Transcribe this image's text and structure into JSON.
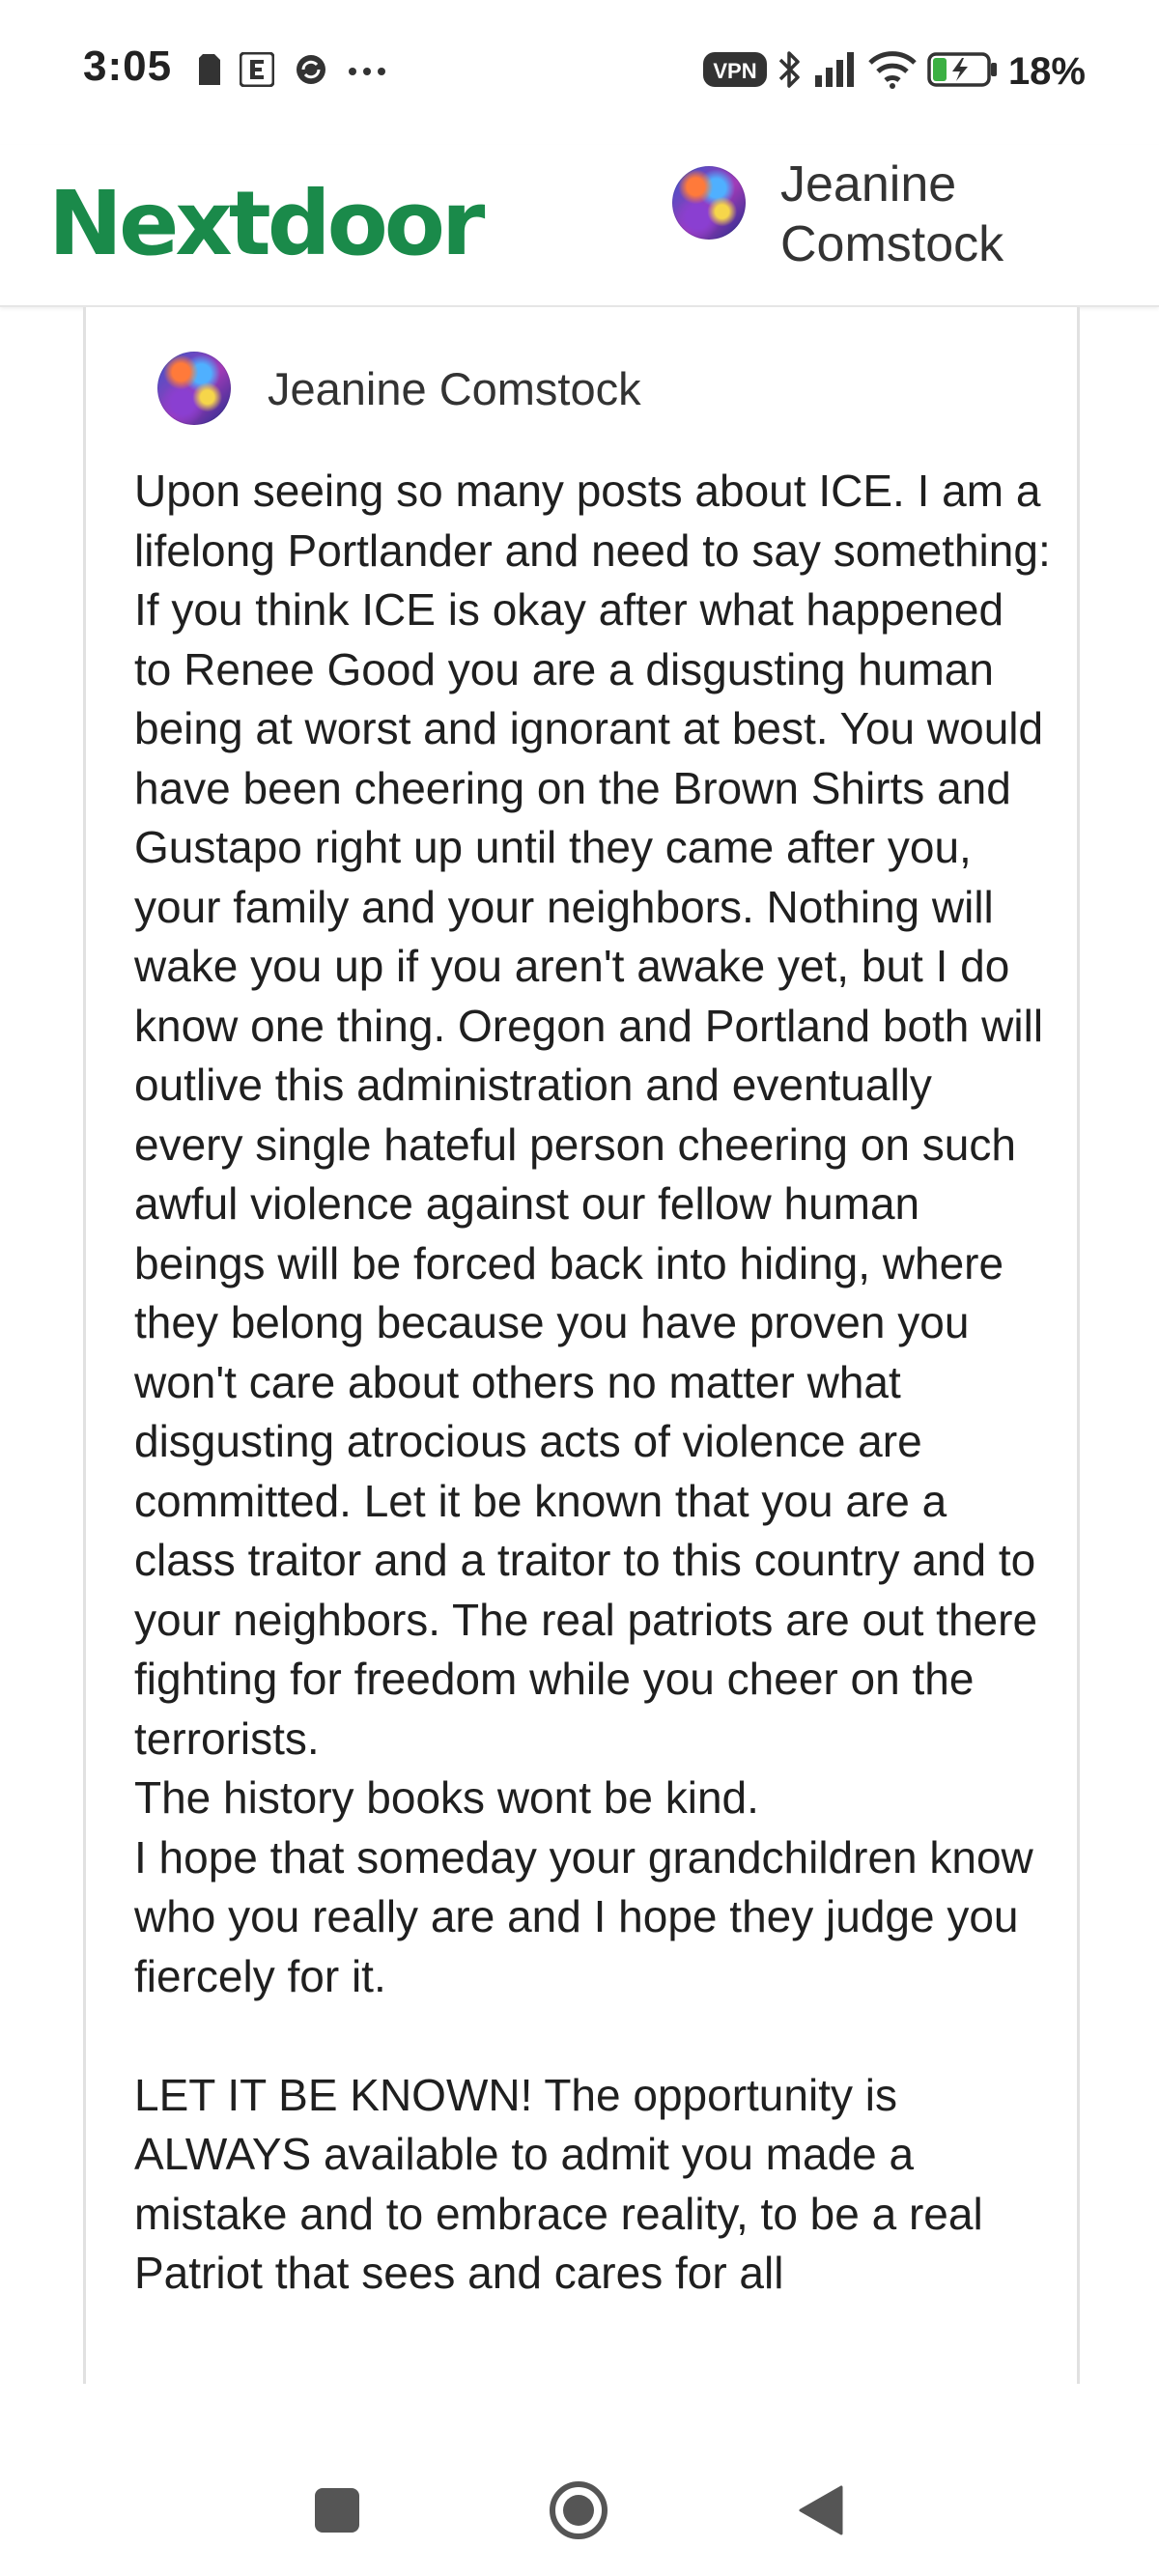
{
  "status_bar": {
    "time": "3:05",
    "left_icons": [
      "sim-card-icon",
      "e-app-icon",
      "sync-icon",
      "more-dots-icon"
    ],
    "right_icons": [
      "vpn-badge-icon",
      "bluetooth-icon",
      "signal-icon",
      "wifi-icon",
      "battery-charging-icon"
    ],
    "vpn_label": "VPN",
    "battery_percent": "18%"
  },
  "header": {
    "brand": "Nextdoor",
    "brand_color": "#1a8a4a",
    "user_name": "Jeanine Comstock"
  },
  "post": {
    "author": "Jeanine Comstock",
    "paragraphs": [
      "Upon seeing so many posts about ICE. I am a lifelong Portlander and need to say something: If you think ICE is okay after what happened to Renee Good you are a disgusting human being at worst and ignorant at best. You would have been cheering on the Brown Shirts and Gustapo right up until they came after you, your family and your neighbors. Nothing will wake you up if you aren't awake yet, but I do know one thing. Oregon and Portland both will outlive this administration and eventually every single hateful person cheering on such awful violence against our fellow human beings will be forced back into hiding, where they belong because you have proven you won't care about others no matter what disgusting atrocious acts of violence are committed. Let it be known that you are a class traitor and a traitor to this country and to your neighbors. The real patriots are out there fighting for freedom while you cheer on the terrorists.",
      "The history books wont be kind.",
      "I hope that someday your grandchildren know who you really are and I hope they judge you fiercely for it.",
      "",
      "LET IT BE KNOWN! The opportunity is ALWAYS available to admit you made a mistake and to embrace reality, to be a real Patriot that sees and cares for all"
    ]
  },
  "nav": {
    "icons": [
      "recents-square-icon",
      "home-circle-icon",
      "back-triangle-icon"
    ]
  }
}
